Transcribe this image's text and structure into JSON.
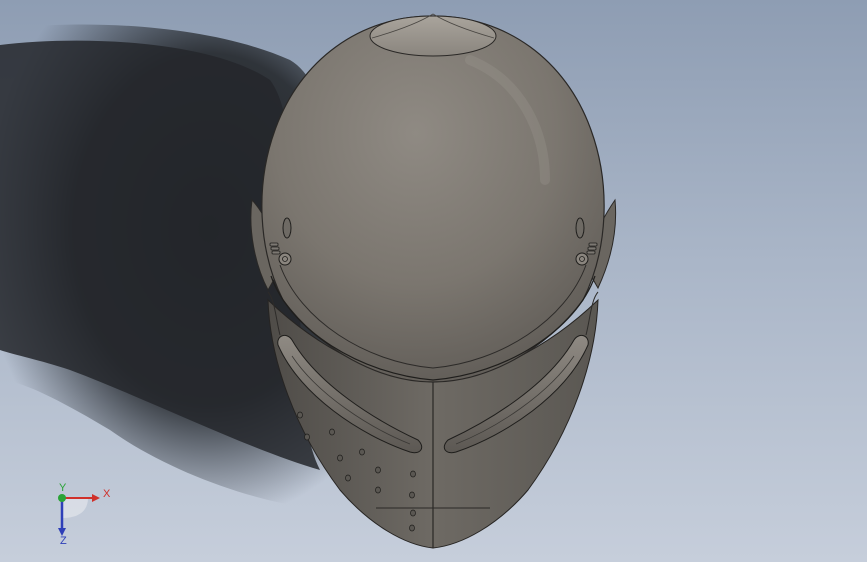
{
  "viewport": {
    "background_top": "#8e9db3",
    "background_bottom": "#c6cedb",
    "model": "helmet",
    "model_color": "#7c7872",
    "shadow_color": "#26292d"
  },
  "triad": {
    "x_label": "X",
    "y_label": "Y",
    "z_label": "Z",
    "x_color": "#d0302a",
    "y_color": "#2aa336",
    "z_color": "#2e3fb8"
  }
}
